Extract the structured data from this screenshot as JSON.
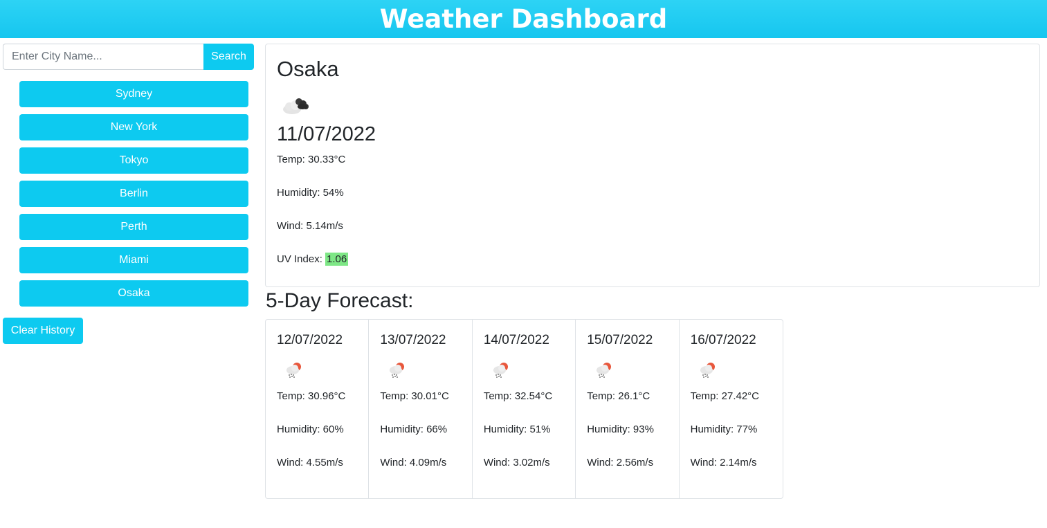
{
  "header": {
    "title": "Weather Dashboard"
  },
  "search": {
    "placeholder": "Enter City Name...",
    "button_label": "Search"
  },
  "history": [
    "Sydney",
    "New York",
    "Tokyo",
    "Berlin",
    "Perth",
    "Miami",
    "Osaka"
  ],
  "clear_label": "Clear History",
  "current": {
    "city": "Osaka",
    "icon": "broken-clouds-icon",
    "date": "11/07/2022",
    "temp": "Temp: 30.33°C",
    "humidity": "Humidity: 54%",
    "wind": "Wind: 5.14m/s",
    "uv_label": "UV Index: ",
    "uv_value": "1.06",
    "uv_color": "#7ee786"
  },
  "forecast": {
    "title": "5-Day Forecast:",
    "days": [
      {
        "date": "12/07/2022",
        "icon": "rain-sun-icon",
        "temp": "Temp: 30.96°C",
        "humidity": "Humidity: 60%",
        "wind": "Wind: 4.55m/s"
      },
      {
        "date": "13/07/2022",
        "icon": "rain-sun-icon",
        "temp": "Temp: 30.01°C",
        "humidity": "Humidity: 66%",
        "wind": "Wind: 4.09m/s"
      },
      {
        "date": "14/07/2022",
        "icon": "rain-sun-icon",
        "temp": "Temp: 32.54°C",
        "humidity": "Humidity: 51%",
        "wind": "Wind: 3.02m/s"
      },
      {
        "date": "15/07/2022",
        "icon": "rain-sun-icon",
        "temp": "Temp: 26.1°C",
        "humidity": "Humidity: 93%",
        "wind": "Wind: 2.56m/s"
      },
      {
        "date": "16/07/2022",
        "icon": "rain-sun-icon",
        "temp": "Temp: 27.42°C",
        "humidity": "Humidity: 77%",
        "wind": "Wind: 2.14m/s"
      }
    ]
  },
  "colors": {
    "accent": "#0dcaf0",
    "header": "#16c6ef"
  }
}
